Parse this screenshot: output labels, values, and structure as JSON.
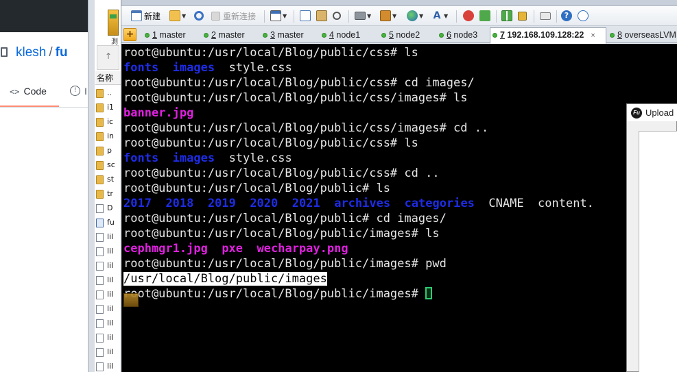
{
  "github": {
    "owner": "klesh",
    "separator": "/",
    "repo": "fu",
    "code_tab": "Code",
    "code_icon_glyph": "<>",
    "issues_icon_glyph": "!",
    "issues_label_fragment": "I"
  },
  "file_pane": {
    "header": "名称",
    "top_label": "測",
    "rows": [
      {
        "icon": "folder",
        "name": ".."
      },
      {
        "icon": "folder",
        "name": "i1"
      },
      {
        "icon": "folder",
        "name": "ic"
      },
      {
        "icon": "folder",
        "name": "in"
      },
      {
        "icon": "folder",
        "name": "p"
      },
      {
        "icon": "folder",
        "name": "sc"
      },
      {
        "icon": "folder",
        "name": "st"
      },
      {
        "icon": "folder",
        "name": "tr"
      },
      {
        "icon": "doc",
        "name": "D"
      },
      {
        "icon": "fu",
        "name": "fu"
      },
      {
        "icon": "doc",
        "name": "lil"
      },
      {
        "icon": "doc",
        "name": "lil"
      },
      {
        "icon": "doc",
        "name": "lil"
      },
      {
        "icon": "doc",
        "name": "lil"
      },
      {
        "icon": "doc",
        "name": "lil"
      },
      {
        "icon": "doc",
        "name": "lil"
      },
      {
        "icon": "doc",
        "name": "lil"
      },
      {
        "icon": "doc",
        "name": "lil"
      },
      {
        "icon": "doc",
        "name": "lil"
      },
      {
        "icon": "doc",
        "name": "lil"
      },
      {
        "icon": "doc",
        "name": "lil"
      }
    ]
  },
  "toolbar": {
    "new_label": "新建",
    "reconnect_label": "重新连接"
  },
  "tabs": [
    {
      "num": "1",
      "label": " master"
    },
    {
      "num": "2",
      "label": " master"
    },
    {
      "num": "3",
      "label": " master"
    },
    {
      "num": "4",
      "label": " node1"
    },
    {
      "num": "5",
      "label": " node2"
    },
    {
      "num": "6",
      "label": " node3"
    },
    {
      "num": "7",
      "label": " 192.168.109.128:22",
      "active": true,
      "close": "×"
    },
    {
      "num": "8",
      "label": " overseasLVM"
    }
  ],
  "terminal": {
    "lines": [
      [
        {
          "t": "root@ubuntu:/usr/local/Blog/public/css# ls"
        }
      ],
      [
        {
          "t": "fonts",
          "c": "blue"
        },
        {
          "t": "  "
        },
        {
          "t": "images",
          "c": "blue"
        },
        {
          "t": "  style.css"
        }
      ],
      [
        {
          "t": "root@ubuntu:/usr/local/Blog/public/css# cd images/"
        }
      ],
      [
        {
          "t": "root@ubuntu:/usr/local/Blog/public/css/images# ls"
        }
      ],
      [
        {
          "t": "banner.jpg",
          "c": "mag"
        }
      ],
      [
        {
          "t": "root@ubuntu:/usr/local/Blog/public/css/images# cd .."
        }
      ],
      [
        {
          "t": "root@ubuntu:/usr/local/Blog/public/css# ls"
        }
      ],
      [
        {
          "t": "fonts",
          "c": "blue"
        },
        {
          "t": "  "
        },
        {
          "t": "images",
          "c": "blue"
        },
        {
          "t": "  style.css"
        }
      ],
      [
        {
          "t": "root@ubuntu:/usr/local/Blog/public/css# cd .."
        }
      ],
      [
        {
          "t": "root@ubuntu:/usr/local/Blog/public# ls"
        }
      ],
      [
        {
          "t": "2017",
          "c": "blue"
        },
        {
          "t": "  "
        },
        {
          "t": "2018",
          "c": "blue"
        },
        {
          "t": "  "
        },
        {
          "t": "2019",
          "c": "blue"
        },
        {
          "t": "  "
        },
        {
          "t": "2020",
          "c": "blue"
        },
        {
          "t": "  "
        },
        {
          "t": "2021",
          "c": "blue"
        },
        {
          "t": "  "
        },
        {
          "t": "archives",
          "c": "blue"
        },
        {
          "t": "  "
        },
        {
          "t": "categories",
          "c": "blue"
        },
        {
          "t": "  CNAME  content."
        }
      ],
      [
        {
          "t": "root@ubuntu:/usr/local/Blog/public# cd images/"
        }
      ],
      [
        {
          "t": "root@ubuntu:/usr/local/Blog/public/images# ls"
        }
      ],
      [
        {
          "t": "cephmgr1.jpg",
          "c": "mag"
        },
        {
          "t": "  "
        },
        {
          "t": "pxe",
          "c": "mag"
        },
        {
          "t": "  "
        },
        {
          "t": "wecharpay.png",
          "c": "mag"
        }
      ],
      [
        {
          "t": "root@ubuntu:/usr/local/Blog/public/images# pwd"
        }
      ],
      [
        {
          "t": "/usr/local/Blog/public/images",
          "c": "sel"
        }
      ],
      [
        {
          "t": "root@ubuntu:/usr/local/Blog/public/images# "
        },
        {
          "cursor": true
        }
      ]
    ]
  },
  "upload_window": {
    "title": "Upload",
    "logo": "Fu"
  }
}
